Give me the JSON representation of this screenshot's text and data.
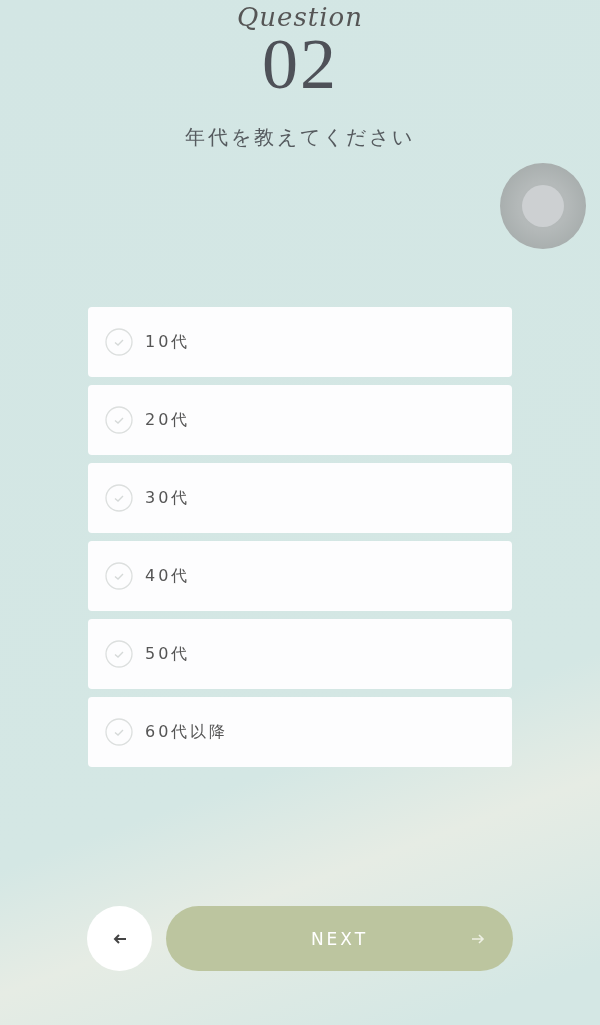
{
  "header": {
    "label": "Question",
    "number": "02"
  },
  "question": "年代を教えてください",
  "options": [
    {
      "label": "10代",
      "selected": false
    },
    {
      "label": "20代",
      "selected": false
    },
    {
      "label": "30代",
      "selected": false
    },
    {
      "label": "40代",
      "selected": false
    },
    {
      "label": "50代",
      "selected": false
    },
    {
      "label": "60代以降",
      "selected": false
    }
  ],
  "next_button": {
    "label": "NEXT",
    "disabled": true
  }
}
